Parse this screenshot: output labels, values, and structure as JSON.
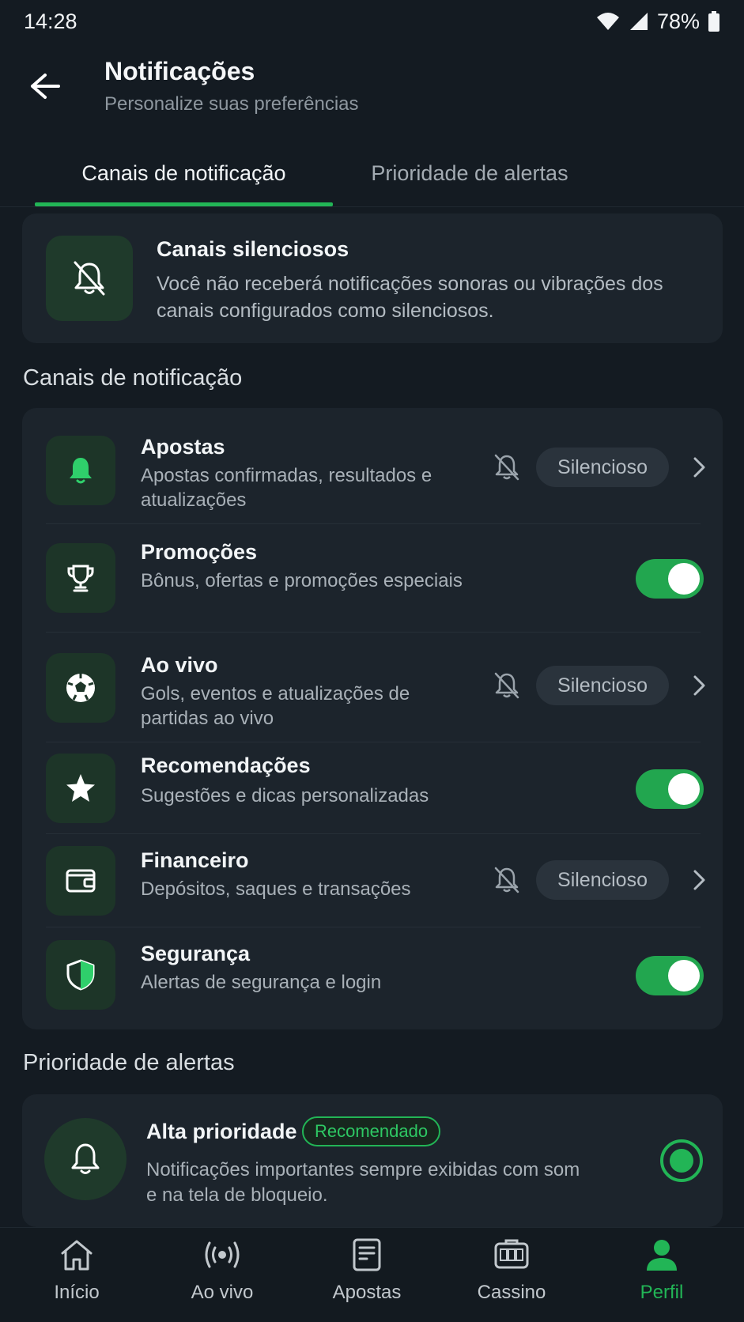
{
  "status_bar": {
    "time": "14:28",
    "battery": "78%"
  },
  "header": {
    "title": "Notificações",
    "subtitle": "Personalize suas preferências"
  },
  "tabs": [
    {
      "label": "Canais de notificação",
      "active": true
    },
    {
      "label": "Prioridade de alertas",
      "active": false
    }
  ],
  "silent_card": {
    "title": "Canais silenciosos",
    "description": "Você não receberá notificações sonoras ou vibrações dos canais configurados como silenciosos.",
    "icon": "bell-off-icon"
  },
  "channels_section": {
    "title": "Canais de notificação",
    "items": [
      {
        "title": "Apostas",
        "description": "Apostas confirmadas, resultados e atualizações",
        "icon": "bell-icon",
        "mode": "Silencioso",
        "enabled": false
      },
      {
        "title": "Promoções",
        "description": "Bônus, ofertas e promoções especiais",
        "icon": "trophy-icon",
        "enabled": true
      },
      {
        "title": "Ao vivo",
        "description": "Gols, eventos e atualizações de partidas ao vivo",
        "icon": "soccer-ball-icon",
        "mode": "Silencioso",
        "enabled": false
      },
      {
        "title": "Recomendações",
        "description": "Sugestões e dicas personalizadas",
        "icon": "star-icon",
        "enabled": true
      },
      {
        "title": "Financeiro",
        "description": "Depósitos, saques e transações",
        "icon": "wallet-icon",
        "mode": "Silencioso",
        "enabled": false
      },
      {
        "title": "Segurança",
        "description": "Alertas de segurança e login",
        "icon": "shield-icon",
        "enabled": true
      }
    ]
  },
  "priority_section": {
    "title": "Prioridade de alertas",
    "option": {
      "title": "Alta prioridade",
      "badge": "Recomendado",
      "description": "Notificações importantes sempre exibidas com som e na tela de bloqueio.",
      "selected": true
    }
  },
  "bottom_nav": [
    {
      "label": "Início",
      "icon": "home-icon",
      "active": false
    },
    {
      "label": "Ao vivo",
      "icon": "broadcast-icon",
      "active": false
    },
    {
      "label": "Apostas",
      "icon": "bet-slip-icon",
      "active": false
    },
    {
      "label": "Cassino",
      "icon": "slot-machine-icon",
      "active": false
    },
    {
      "label": "Perfil",
      "icon": "user-icon",
      "active": true
    }
  ],
  "colors": {
    "accent": "#22b556",
    "background": "#141b22",
    "card": "#1c242c"
  }
}
